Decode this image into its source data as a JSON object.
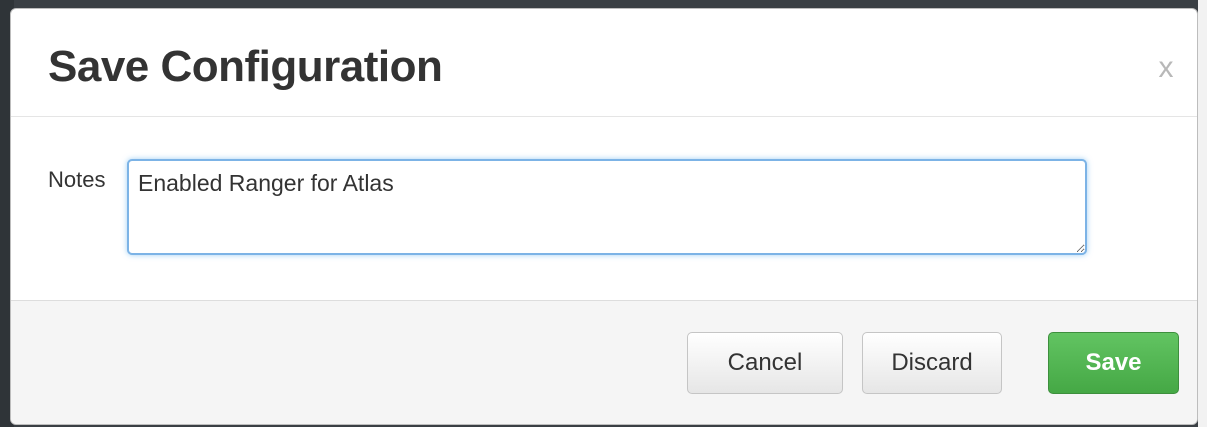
{
  "dialog": {
    "title": "Save Configuration",
    "close_label": "x"
  },
  "notes": {
    "label": "Notes",
    "value": "Enabled Ranger for Atlas"
  },
  "footer": {
    "cancel_label": "Cancel",
    "discard_label": "Discard",
    "save_label": "Save"
  },
  "colors": {
    "save_button": "#5cb85c",
    "focus_border": "#7cb3e6"
  }
}
